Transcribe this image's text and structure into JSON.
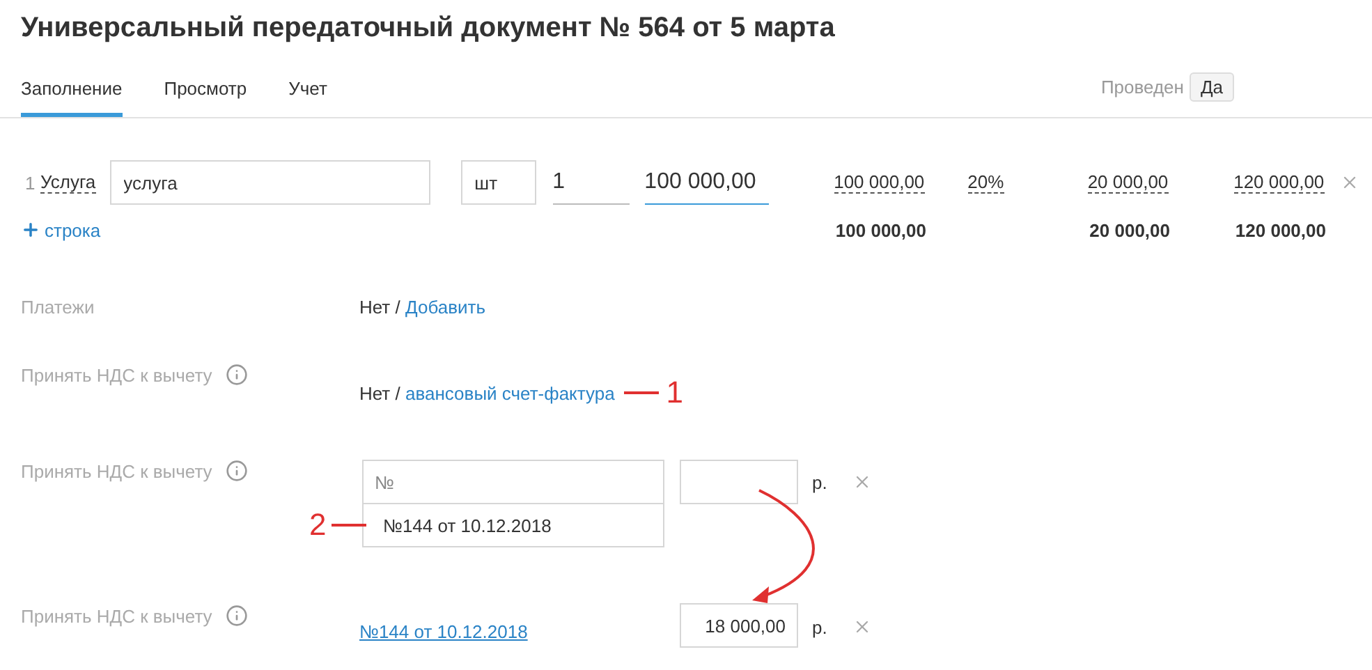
{
  "title": "Универсальный передаточный документ № 564 от 5 марта",
  "tabs": [
    {
      "label": "Заполнение",
      "selected": true
    },
    {
      "label": "Просмотр",
      "selected": false
    },
    {
      "label": "Учет",
      "selected": false
    }
  ],
  "posted": {
    "label": "Проведен",
    "value": "Да"
  },
  "line_items": [
    {
      "number": "1",
      "type": "Услуга",
      "name": "услуга",
      "unit": "шт",
      "quantity": "1",
      "price": "100 000,00",
      "amount": "100 000,00",
      "vat_rate": "20%",
      "vat": "20 000,00",
      "total": "120 000,00"
    }
  ],
  "add_row": {
    "label": "строка"
  },
  "totals": {
    "amount": "100 000,00",
    "vat": "20 000,00",
    "total": "120 000,00"
  },
  "payments": {
    "label": "Платежи",
    "value": "Нет",
    "separator": "/",
    "link": "Добавить"
  },
  "vat_rows": [
    {
      "kind": "link",
      "label": "Принять НДС к вычету",
      "value": "Нет",
      "separator": "/",
      "link": "авансовый счет-фактура",
      "annotation": "1"
    },
    {
      "kind": "search",
      "label": "Принять НДС к вычету",
      "placeholder": "№",
      "suggestion": "№144 от 10.12.2018",
      "currency": "р.",
      "annotation": "2"
    },
    {
      "kind": "selected",
      "label": "Принять НДС к вычету",
      "document": "№144 от 10.12.2018",
      "amount": "18 000,00",
      "currency": "р."
    }
  ]
}
